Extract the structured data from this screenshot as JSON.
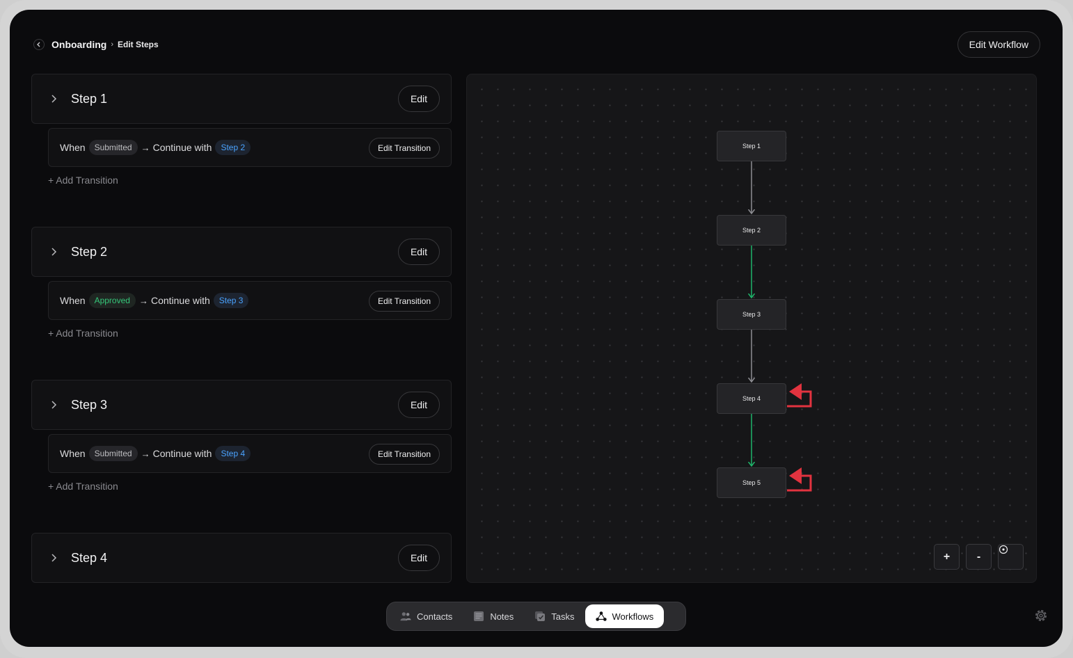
{
  "header": {
    "back_icon": "chevron-left-icon",
    "breadcrumb_main": "Onboarding",
    "breadcrumb_sep": "›",
    "breadcrumb_sub": "Edit Steps",
    "edit_workflow_label": "Edit Workflow"
  },
  "steps": [
    {
      "title": "Step 1",
      "edit_label": "Edit",
      "transition": {
        "when": "When",
        "trigger": "Submitted",
        "arrow": "→",
        "continue": "Continue with",
        "target": "Step 2",
        "edit_label": "Edit Transition"
      },
      "add_label": "+ Add Transition"
    },
    {
      "title": "Step 2",
      "edit_label": "Edit",
      "transition": {
        "when": "When",
        "trigger": "Approved",
        "arrow": "→",
        "continue": "Continue with",
        "target": "Step 3",
        "edit_label": "Edit Transition"
      },
      "add_label": "+ Add Transition"
    },
    {
      "title": "Step 3",
      "edit_label": "Edit",
      "transition": {
        "when": "When",
        "trigger": "Submitted",
        "arrow": "→",
        "continue": "Continue with",
        "target": "Step 4",
        "edit_label": "Edit Transition"
      },
      "add_label": "+ Add Transition"
    },
    {
      "title": "Step 4",
      "edit_label": "Edit"
    }
  ],
  "diagram": {
    "nodes": [
      "Step 1",
      "Step 2",
      "Step 3",
      "Step 4",
      "Step 5"
    ],
    "edge_colors": {
      "neutral": "#8d8d92",
      "approved": "#1fb56a",
      "loop": "#e2333f"
    },
    "edges": [
      {
        "from": "Step 1",
        "to": "Step 2",
        "kind": "neutral"
      },
      {
        "from": "Step 2",
        "to": "Step 3",
        "kind": "approved"
      },
      {
        "from": "Step 3",
        "to": "Step 4",
        "kind": "neutral"
      },
      {
        "from": "Step 4",
        "to": "Step 5",
        "kind": "approved"
      },
      {
        "from": "Step 4",
        "to": "Step 4",
        "kind": "loop"
      },
      {
        "from": "Step 5",
        "to": "Step 5",
        "kind": "loop"
      }
    ],
    "zoom_in": "+",
    "zoom_out": "-",
    "fit_icon": "target-icon"
  },
  "nav": {
    "items": [
      {
        "label": "Contacts",
        "icon": "people-icon",
        "active": false
      },
      {
        "label": "Notes",
        "icon": "note-icon",
        "active": false
      },
      {
        "label": "Tasks",
        "icon": "tasks-icon",
        "active": false
      },
      {
        "label": "Workflows",
        "icon": "workflow-icon",
        "active": true
      }
    ],
    "settings_icon": "gear-icon"
  },
  "colors": {
    "accent_blue": "#4aa3ff",
    "accent_green": "#35c77a",
    "loop_red": "#e2333f"
  }
}
